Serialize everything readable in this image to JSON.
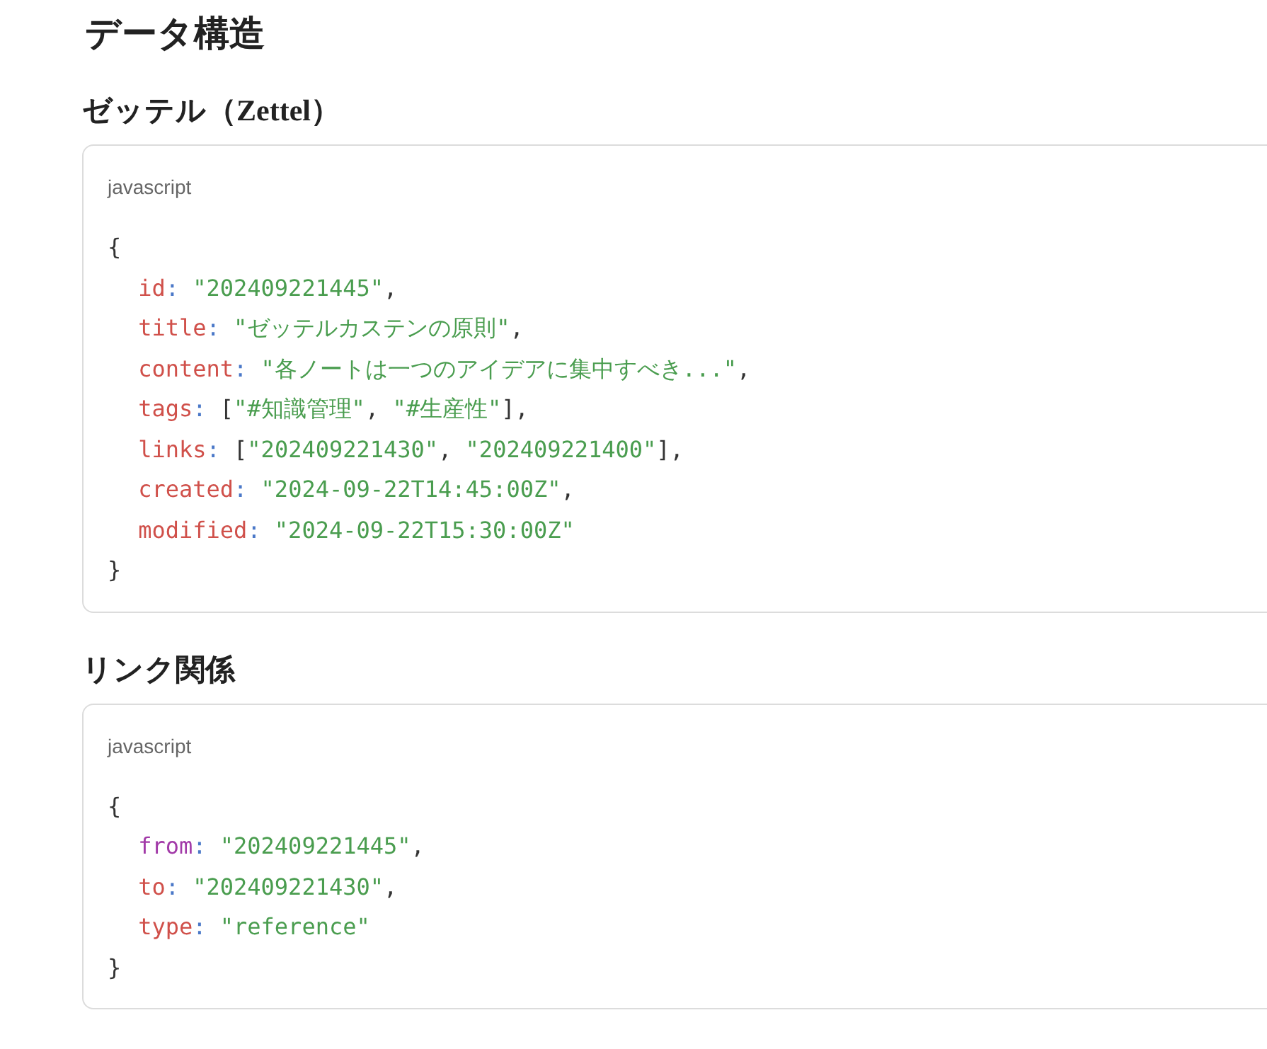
{
  "heading": "データ構造",
  "sections": [
    {
      "title": "ゼッテル（Zettel）",
      "code": {
        "language": "javascript",
        "lines": [
          {
            "tokens": [
              {
                "kind": "punct",
                "text": "{"
              }
            ],
            "children": [
              {
                "tokens": [
                  {
                    "kind": "key",
                    "text": "id"
                  },
                  {
                    "kind": "colon",
                    "text": ": "
                  },
                  {
                    "kind": "string",
                    "text": "\"202409221445\""
                  },
                  {
                    "kind": "punct",
                    "text": ","
                  }
                ]
              },
              {
                "tokens": [
                  {
                    "kind": "key",
                    "text": "title"
                  },
                  {
                    "kind": "colon",
                    "text": ": "
                  },
                  {
                    "kind": "string",
                    "text": "\"ゼッテルカステンの原則\""
                  },
                  {
                    "kind": "punct",
                    "text": ","
                  }
                ]
              },
              {
                "tokens": [
                  {
                    "kind": "key",
                    "text": "content"
                  },
                  {
                    "kind": "colon",
                    "text": ": "
                  },
                  {
                    "kind": "string",
                    "text": "\"各ノートは一つのアイデアに集中すべき...\""
                  },
                  {
                    "kind": "punct",
                    "text": ","
                  }
                ]
              },
              {
                "tokens": [
                  {
                    "kind": "key",
                    "text": "tags"
                  },
                  {
                    "kind": "colon",
                    "text": ": "
                  },
                  {
                    "kind": "punct",
                    "text": "["
                  },
                  {
                    "kind": "string",
                    "text": "\"#知識管理\""
                  },
                  {
                    "kind": "punct",
                    "text": ", "
                  },
                  {
                    "kind": "string",
                    "text": "\"#生産性\""
                  },
                  {
                    "kind": "punct",
                    "text": "],"
                  }
                ]
              },
              {
                "tokens": [
                  {
                    "kind": "key",
                    "text": "links"
                  },
                  {
                    "kind": "colon",
                    "text": ": "
                  },
                  {
                    "kind": "punct",
                    "text": "["
                  },
                  {
                    "kind": "string",
                    "text": "\"202409221430\""
                  },
                  {
                    "kind": "punct",
                    "text": ", "
                  },
                  {
                    "kind": "string",
                    "text": "\"202409221400\""
                  },
                  {
                    "kind": "punct",
                    "text": "],"
                  }
                ]
              },
              {
                "tokens": [
                  {
                    "kind": "key",
                    "text": "created"
                  },
                  {
                    "kind": "colon",
                    "text": ": "
                  },
                  {
                    "kind": "string",
                    "text": "\"2024-09-22T14:45:00Z\""
                  },
                  {
                    "kind": "punct",
                    "text": ","
                  }
                ]
              },
              {
                "tokens": [
                  {
                    "kind": "key",
                    "text": "modified"
                  },
                  {
                    "kind": "colon",
                    "text": ": "
                  },
                  {
                    "kind": "string",
                    "text": "\"2024-09-22T15:30:00Z\""
                  }
                ]
              }
            ]
          },
          {
            "tokens": [
              {
                "kind": "punct",
                "text": "}"
              }
            ]
          }
        ]
      }
    },
    {
      "title": "リンク関係",
      "code": {
        "language": "javascript",
        "lines": [
          {
            "tokens": [
              {
                "kind": "punct",
                "text": "{"
              }
            ],
            "children": [
              {
                "tokens": [
                  {
                    "kind": "keyword",
                    "text": "from"
                  },
                  {
                    "kind": "colon",
                    "text": ": "
                  },
                  {
                    "kind": "string",
                    "text": "\"202409221445\""
                  },
                  {
                    "kind": "punct",
                    "text": ","
                  }
                ]
              },
              {
                "tokens": [
                  {
                    "kind": "key",
                    "text": "to"
                  },
                  {
                    "kind": "colon",
                    "text": ": "
                  },
                  {
                    "kind": "string",
                    "text": "\"202409221430\""
                  },
                  {
                    "kind": "punct",
                    "text": ","
                  }
                ]
              },
              {
                "tokens": [
                  {
                    "kind": "key",
                    "text": "type"
                  },
                  {
                    "kind": "colon",
                    "text": ": "
                  },
                  {
                    "kind": "string",
                    "text": "\"reference\""
                  }
                ]
              }
            ]
          },
          {
            "tokens": [
              {
                "kind": "punct",
                "text": "}"
              }
            ]
          }
        ]
      }
    }
  ]
}
